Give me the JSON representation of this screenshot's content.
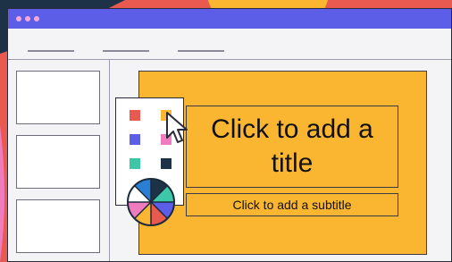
{
  "colors": {
    "background_coral": "#e85a4f",
    "background_navy": "#1d3147",
    "titlebar": "#5c5ee8",
    "window_dots": "#f7a8d8",
    "slide_fill": "#fbb631"
  },
  "window": {
    "dots": [
      "dot-1",
      "dot-2",
      "dot-3"
    ]
  },
  "slide": {
    "title_placeholder": "Click to add a title",
    "subtitle_placeholder": "Click to add a subtitle"
  },
  "thumbnails": [
    "slide-1",
    "slide-2",
    "slide-3"
  ],
  "palette": {
    "swatches": [
      "#e85a4f",
      "#fbb631",
      "#5c5ee8",
      "#f07cc0",
      "#3ec6a8",
      "#1d3147"
    ],
    "color_wheel_icon": "color-wheel-icon"
  },
  "cursor_icon": "arrow-cursor-icon"
}
